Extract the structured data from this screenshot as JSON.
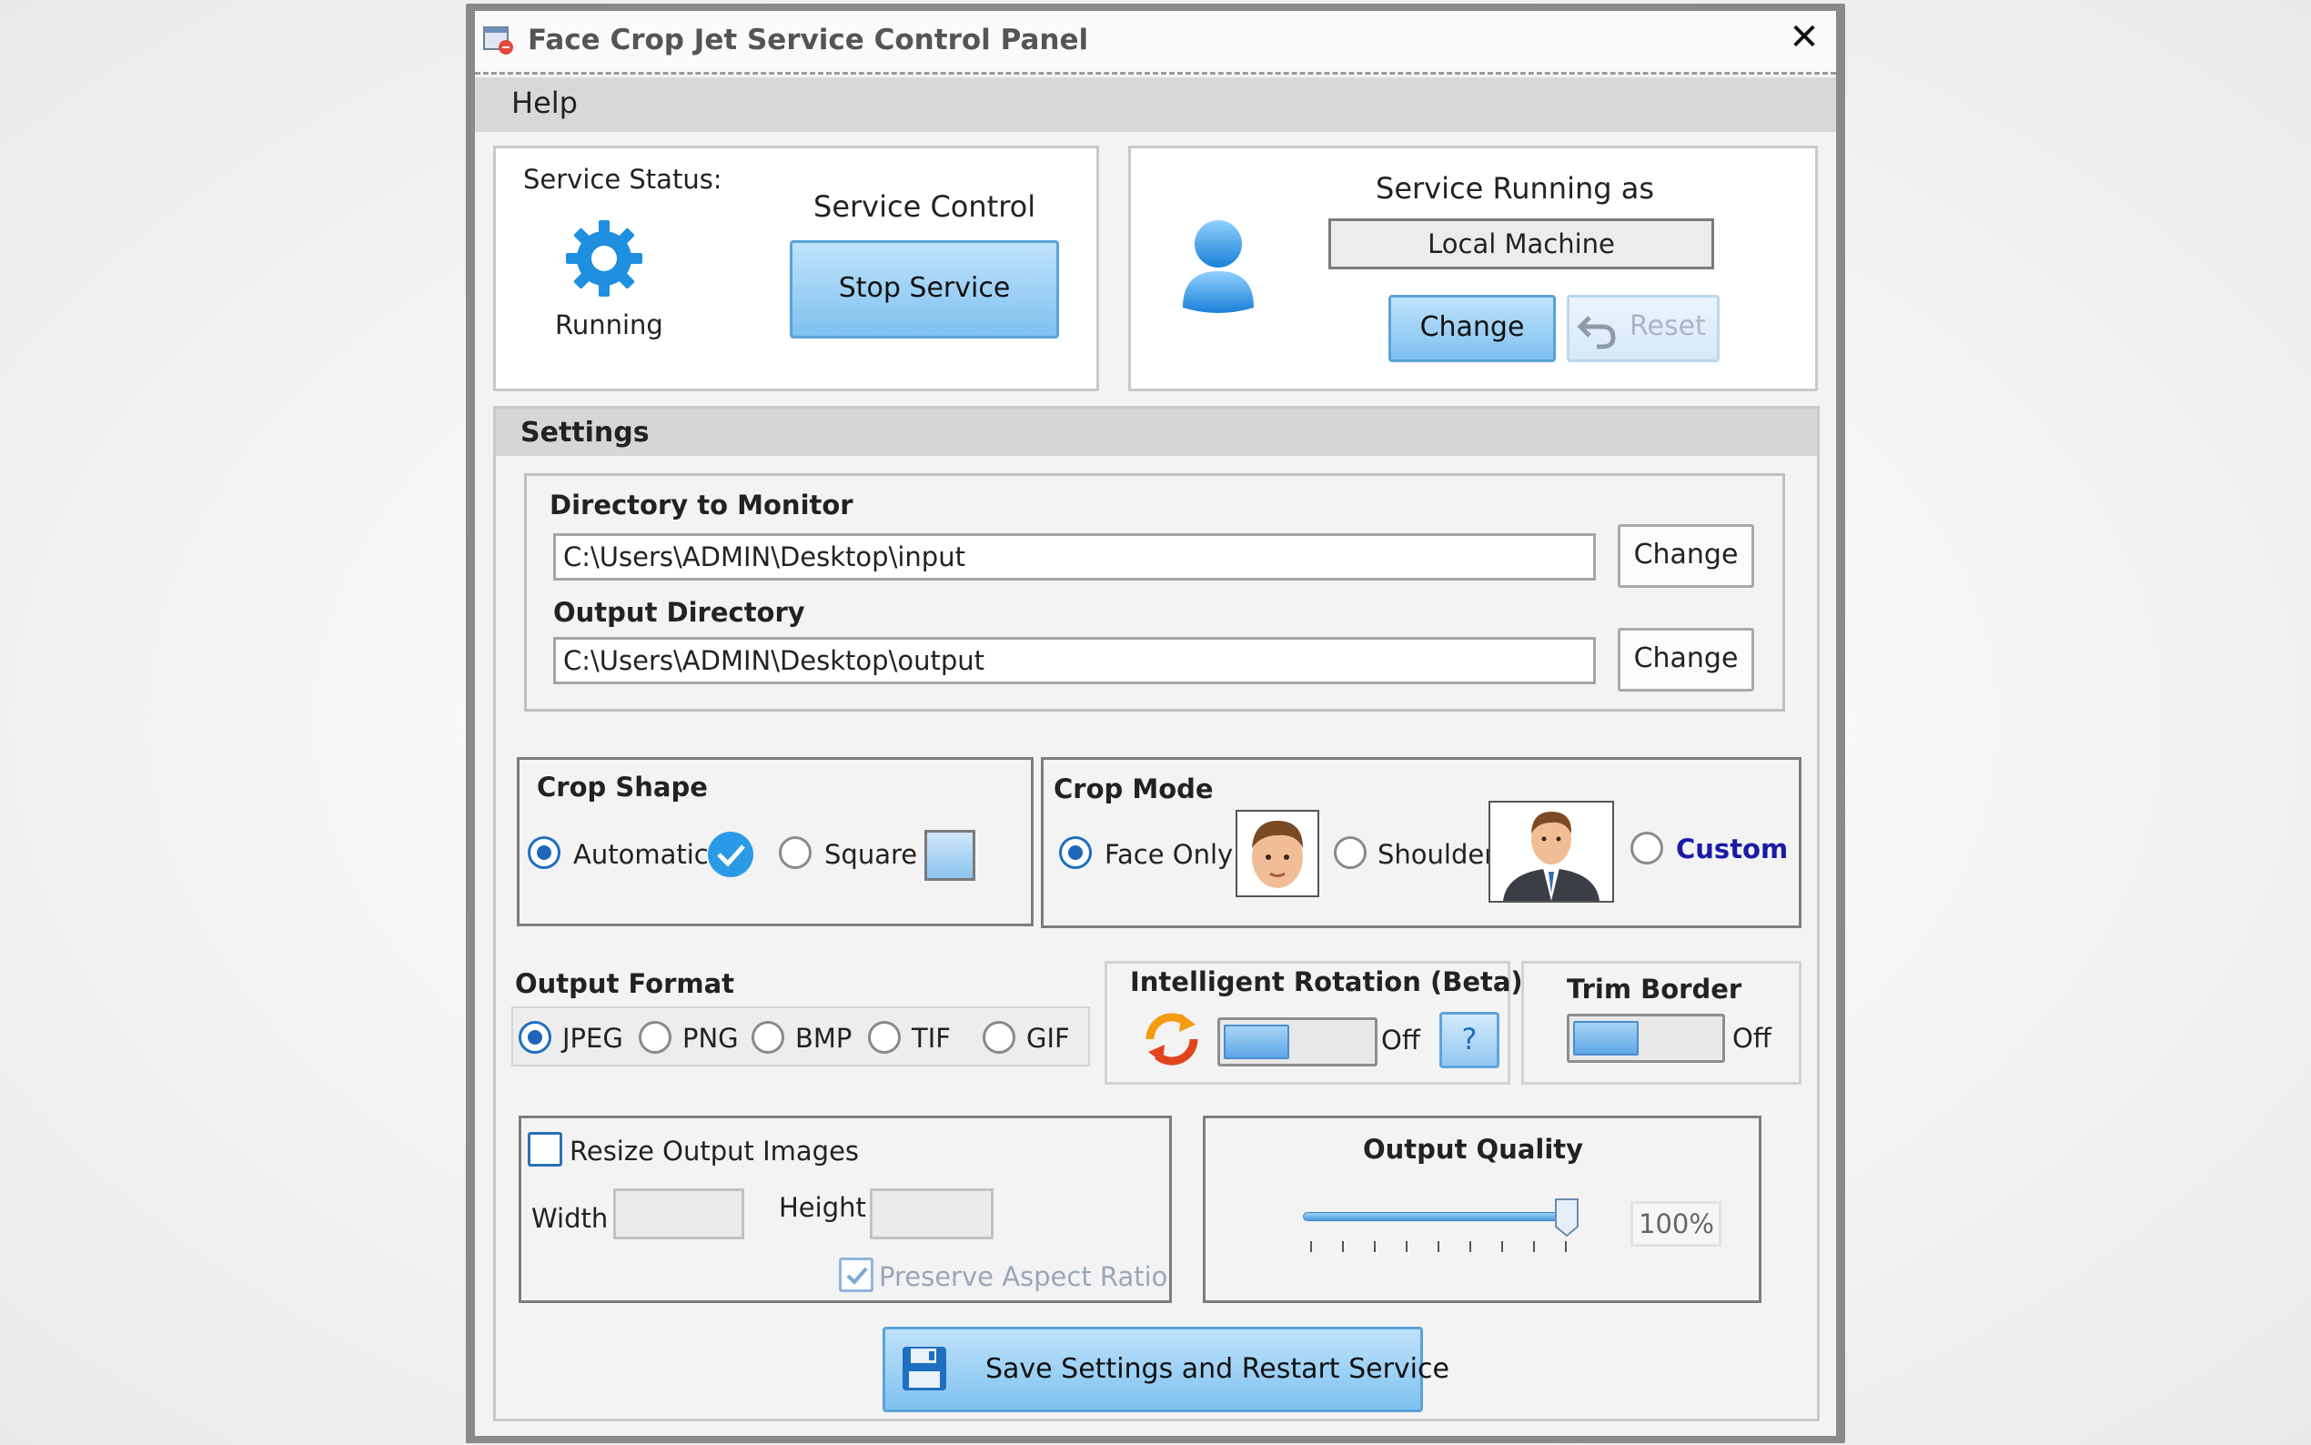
{
  "window": {
    "title": "Face Crop Jet Service Control Panel",
    "close_glyph": "✕"
  },
  "menu": {
    "help": "Help"
  },
  "service": {
    "status_label": "Service Status:",
    "status_value": "Running",
    "control_label": "Service Control",
    "stop_button": "Stop Service",
    "running_as_label": "Service Running as",
    "running_as_value": "Local Machine",
    "change_button": "Change",
    "reset_button": "Reset"
  },
  "settings": {
    "header": "Settings",
    "directory_to_monitor_label": "Directory to Monitor",
    "directory_to_monitor_value": "C:\\Users\\ADMIN\\Desktop\\input",
    "output_directory_label": "Output Directory",
    "output_directory_value": "C:\\Users\\ADMIN\\Desktop\\output",
    "change_label": "Change"
  },
  "crop_shape": {
    "label": "Crop Shape",
    "options": [
      "Automatic",
      "Square"
    ],
    "selected": "Automatic"
  },
  "crop_mode": {
    "label": "Crop Mode",
    "options": [
      "Face Only",
      "Shoulder",
      "Custom"
    ],
    "selected": "Face Only"
  },
  "output_format": {
    "label": "Output Format",
    "options": [
      "JPEG",
      "PNG",
      "BMP",
      "TIF",
      "GIF"
    ],
    "selected": "JPEG"
  },
  "intelligent_rotation": {
    "label": "Intelligent Rotation (Beta)",
    "state": "Off",
    "help_glyph": "?"
  },
  "trim_border": {
    "label": "Trim Border",
    "state": "Off"
  },
  "resize": {
    "label": "Resize Output Images",
    "checked": false,
    "width_label": "Width",
    "height_label": "Height",
    "width_value": "",
    "height_value": "",
    "preserve_label": "Preserve Aspect Ratio",
    "preserve_checked": true
  },
  "output_quality": {
    "label": "Output Quality",
    "value_text": "100%",
    "value": 1.0
  },
  "save_button": "Save Settings and Restart Service",
  "colors": {
    "accent": "#1d66b8",
    "button_blue": "#7fc1f0",
    "custom_link": "#1a1aa6"
  }
}
